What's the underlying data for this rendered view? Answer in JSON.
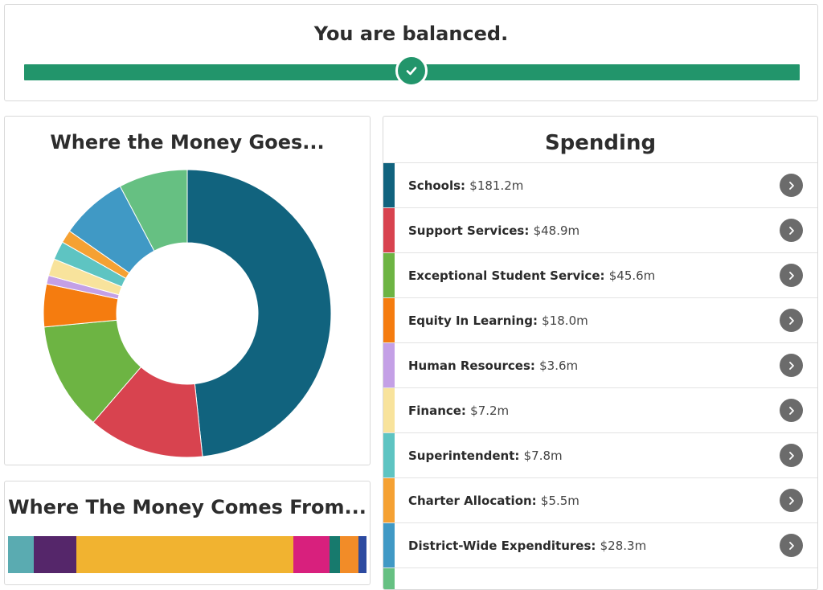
{
  "balance": {
    "title": "You are balanced.",
    "status_color": "#22956b",
    "indicator_icon": "check-icon"
  },
  "goes": {
    "title": "Where the Money Goes..."
  },
  "comes": {
    "title": "Where The Money Comes From...",
    "segments": [
      {
        "value": 7.2,
        "color": "#5aabb1"
      },
      {
        "value": 11.8,
        "color": "#55266a"
      },
      {
        "value": 60.5,
        "color": "#f1b330"
      },
      {
        "value": 10.2,
        "color": "#d8207d"
      },
      {
        "value": 2.9,
        "color": "#177a6d"
      },
      {
        "value": 5.2,
        "color": "#f28c28"
      },
      {
        "value": 2.2,
        "color": "#2c4aa0"
      }
    ]
  },
  "spending": {
    "title": "Spending",
    "button_icon": "chevron-right-icon",
    "items": [
      {
        "label": "Schools:",
        "amount": "$181.2m",
        "value": 181.2,
        "color": "#11637e"
      },
      {
        "label": "Support Services:",
        "amount": "$48.9m",
        "value": 48.9,
        "color": "#d8434f"
      },
      {
        "label": "Exceptional Student Service:",
        "amount": "$45.6m",
        "value": 45.6,
        "color": "#6db443"
      },
      {
        "label": "Equity In Learning:",
        "amount": "$18.0m",
        "value": 18.0,
        "color": "#f57c0f"
      },
      {
        "label": "Human Resources:",
        "amount": "$3.6m",
        "value": 3.6,
        "color": "#c4a0e6"
      },
      {
        "label": "Finance:",
        "amount": "$7.2m",
        "value": 7.2,
        "color": "#f8e39c"
      },
      {
        "label": "Superintendent:",
        "amount": "$7.8m",
        "value": 7.8,
        "color": "#5ec4c2"
      },
      {
        "label": "Charter Allocation:",
        "amount": "$5.5m",
        "value": 5.5,
        "color": "#f5a133"
      },
      {
        "label": "District-Wide Expenditures:",
        "amount": "$28.3m",
        "value": 28.3,
        "color": "#4099c5"
      },
      {
        "label": "",
        "amount": "",
        "value": 29.0,
        "color": "#66c082"
      }
    ]
  }
}
